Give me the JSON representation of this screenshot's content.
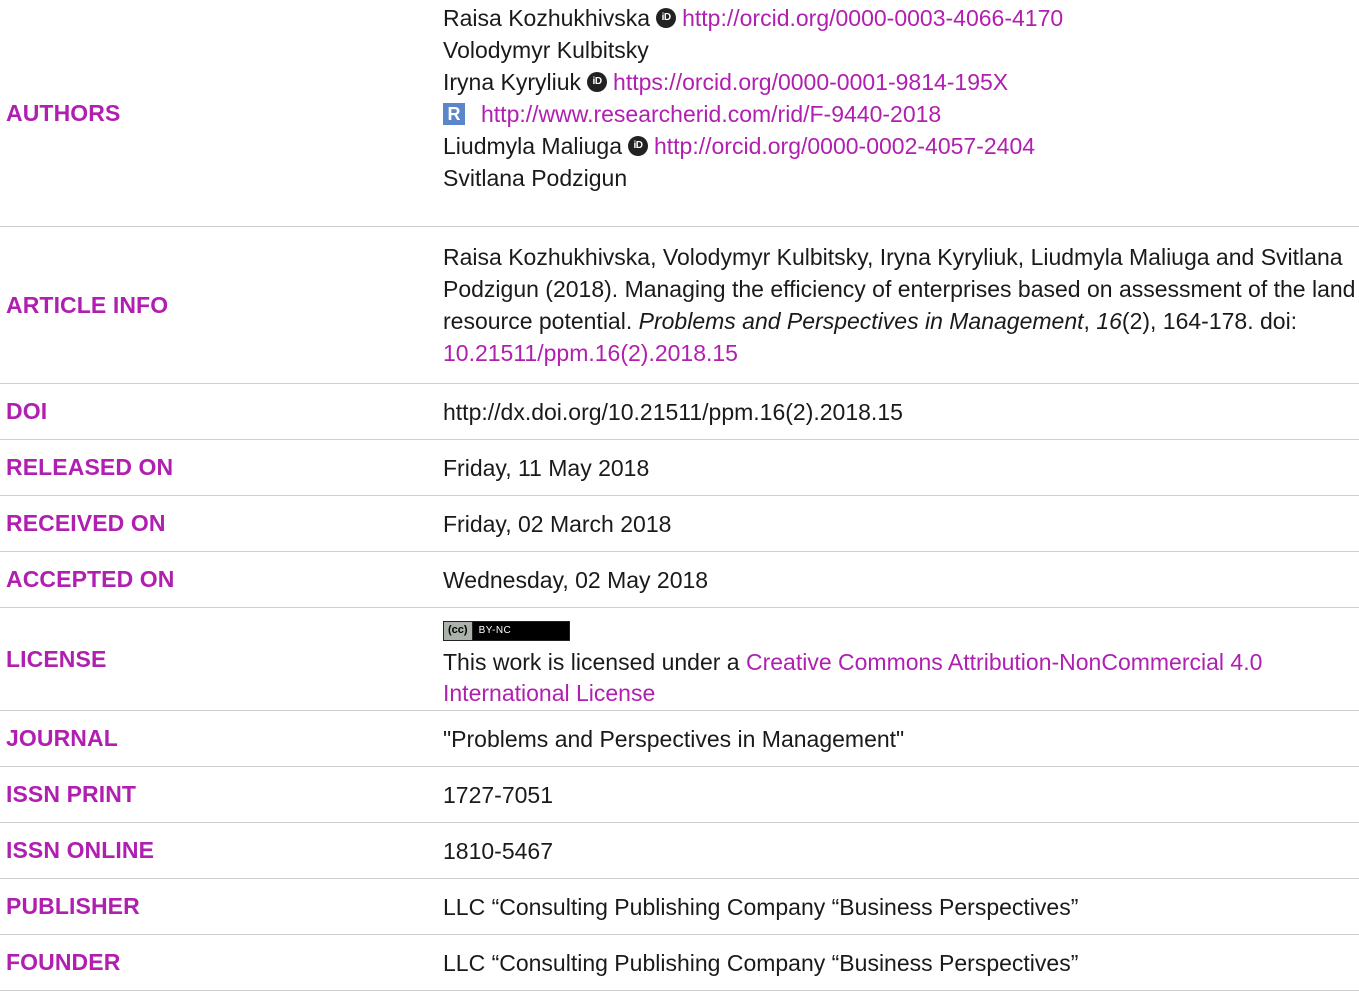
{
  "rows": {
    "authors": {
      "label": "AUTHORS",
      "lines": [
        {
          "name": "Raisa Kozhukhivska",
          "orcid_url": "http://orcid.org/0000-0003-4066-4170"
        },
        {
          "name": "Volodymyr Kulbitsky"
        },
        {
          "name": "Iryna Kyryliuk",
          "orcid_url": "https://orcid.org/0000-0001-9814-195X"
        },
        {
          "researcherid_url": "http://www.researcherid.com/rid/F-9440-2018"
        },
        {
          "name": "Liudmyla Maliuga",
          "orcid_url": "http://orcid.org/0000-0002-4057-2404"
        },
        {
          "name": "Svitlana Podzigun"
        }
      ]
    },
    "article_info": {
      "label": "ARTICLE INFO",
      "citation_prefix": "Raisa Kozhukhivska, Volodymyr Kulbitsky, Iryna Kyryliuk, Liudmyla Maliuga and Svitlana Podzigun (2018). Managing the efficiency of enterprises based on assessment of the land resource potential. ",
      "journal_title": "Problems and Perspectives in Management",
      "sep1": ", ",
      "volume": "16",
      "issue_pages": "(2), 164-178. doi: ",
      "doi_link": "10.21511/ppm.16(2).2018.15"
    },
    "doi": {
      "label": "DOI",
      "value": "http://dx.doi.org/10.21511/ppm.16(2).2018.15"
    },
    "released_on": {
      "label": "RELEASED ON",
      "value": "Friday, 11 May 2018"
    },
    "received_on": {
      "label": "RECEIVED ON",
      "value": "Friday, 02 March 2018"
    },
    "accepted_on": {
      "label": "ACCEPTED ON",
      "value": "Wednesday, 02 May 2018"
    },
    "license": {
      "label": "LICENSE",
      "badge_cc": "(cc)",
      "badge_terms": "BY-NC",
      "text_prefix": "This work is licensed under a ",
      "link_text": "Creative Commons Attribution-NonCommercial 4.0 International License"
    },
    "journal": {
      "label": "JOURNAL",
      "value": "\"Problems and Perspectives in Management\""
    },
    "issn_print": {
      "label": "ISSN PRINT",
      "value": "1727-7051"
    },
    "issn_online": {
      "label": "ISSN ONLINE",
      "value": "1810-5467"
    },
    "publisher": {
      "label": "PUBLISHER",
      "value": "LLC “Consulting Publishing Company “Business Perspectives”"
    },
    "founder": {
      "label": "FOUNDER",
      "value": "LLC “Consulting Publishing Company “Business Perspectives”"
    }
  },
  "icons": {
    "orcid": "orcid-icon",
    "researcherid": "researcherid-icon",
    "orcid_glyph": "iD",
    "researcherid_glyph": "R"
  },
  "colors": {
    "accent": "#b01fb0",
    "text": "#1a1a1a",
    "divider": "#cfcfcf"
  }
}
